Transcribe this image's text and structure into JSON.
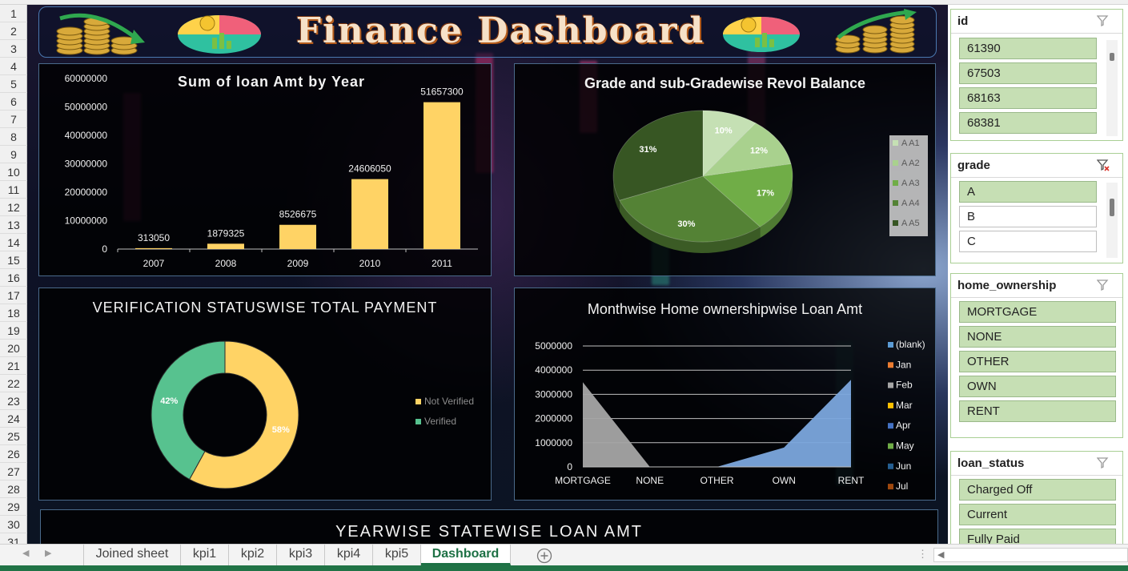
{
  "rows": [
    "1",
    "2",
    "3",
    "4",
    "5",
    "6",
    "7",
    "8",
    "9",
    "10",
    "11",
    "12",
    "13",
    "14",
    "15",
    "16",
    "17",
    "18",
    "19",
    "20",
    "21",
    "22",
    "23",
    "24",
    "25",
    "26",
    "27",
    "28",
    "29",
    "30",
    "31"
  ],
  "dashboard": {
    "title": "Finance Dashboard"
  },
  "chart_data": [
    {
      "type": "bar",
      "title": "Sum of loan Amt by Year",
      "categories": [
        "2007",
        "2008",
        "2009",
        "2010",
        "2011"
      ],
      "values": [
        313050,
        1879325,
        8526675,
        24606050,
        51657300
      ],
      "data_labels": [
        "313050",
        "1879325",
        "8526675",
        "24606050",
        "51657300"
      ],
      "ylim": [
        0,
        60000000
      ],
      "yticks": [
        "0",
        "10000000",
        "20000000",
        "30000000",
        "40000000",
        "50000000",
        "60000000"
      ],
      "color": "#ffd365",
      "grid": false
    },
    {
      "type": "pie",
      "title": "Grade and sub-Gradewise Revol Balance",
      "labels": [
        "A A1",
        "A A2",
        "A A3",
        "A A4",
        "A A5"
      ],
      "values": [
        10,
        12,
        17,
        30,
        31
      ],
      "data_labels": [
        "10%",
        "12%",
        "17%",
        "30%",
        "31%"
      ],
      "colors": [
        "#c5e0b4",
        "#a9d18e",
        "#70ad47",
        "#548235",
        "#375623"
      ],
      "legend": "right"
    },
    {
      "type": "pie",
      "title": "VERIFICATION STATUSWISE TOTAL PAYMENT",
      "labels": [
        "Not Verified",
        "Verified"
      ],
      "values": [
        58,
        42
      ],
      "data_labels": [
        "58%",
        "42%"
      ],
      "colors": [
        "#ffd365",
        "#57c28f"
      ],
      "legend": "right"
    },
    {
      "type": "area",
      "title": "Monthwise Home ownershipwise Loan Amt",
      "categories": [
        "MORTGAGE",
        "NONE",
        "OTHER",
        "OWN",
        "RENT"
      ],
      "series": [
        {
          "name": "(blank)",
          "values": [
            0,
            0,
            0,
            800000,
            3600000
          ],
          "color": "#7ba7dd"
        },
        {
          "name": "Feb",
          "values": [
            3500000,
            0,
            0,
            0,
            0
          ],
          "color": "#a5a5a5"
        }
      ],
      "legend_entries": [
        {
          "name": "(blank)",
          "color": "#5b9bd5"
        },
        {
          "name": "Jan",
          "color": "#ed7d31"
        },
        {
          "name": "Feb",
          "color": "#a5a5a5"
        },
        {
          "name": "Mar",
          "color": "#ffc000"
        },
        {
          "name": "Apr",
          "color": "#4472c4"
        },
        {
          "name": "May",
          "color": "#70ad47"
        },
        {
          "name": "Jun",
          "color": "#255e91"
        },
        {
          "name": "Jul",
          "color": "#9e480e"
        }
      ],
      "ylim": [
        0,
        5000000
      ],
      "yticks": [
        "0",
        "1000000",
        "2000000",
        "3000000",
        "4000000",
        "5000000"
      ],
      "grid": true,
      "legend": "right"
    }
  ],
  "yearwise": {
    "title": "YEARWISE STATEWISE LOAN AMT"
  },
  "slicers": {
    "id": {
      "title": "id",
      "items": [
        "61390",
        "67503",
        "68163",
        "68381"
      ]
    },
    "grade": {
      "title": "grade",
      "items": [
        "A",
        "B",
        "C"
      ]
    },
    "home_ownership": {
      "title": "home_ownership",
      "items": [
        "MORTGAGE",
        "NONE",
        "OTHER",
        "OWN",
        "RENT"
      ]
    },
    "loan_status": {
      "title": "loan_status",
      "items": [
        "Charged Off",
        "Current",
        "Fully Paid"
      ]
    }
  },
  "tabs": [
    "Joined sheet",
    "kpi1",
    "kpi2",
    "kpi3",
    "kpi4",
    "kpi5",
    "Dashboard"
  ],
  "colors": {
    "excel_green": "#217346",
    "slicer_selected": "#c6dfb4",
    "bar_gold": "#ffd365"
  }
}
